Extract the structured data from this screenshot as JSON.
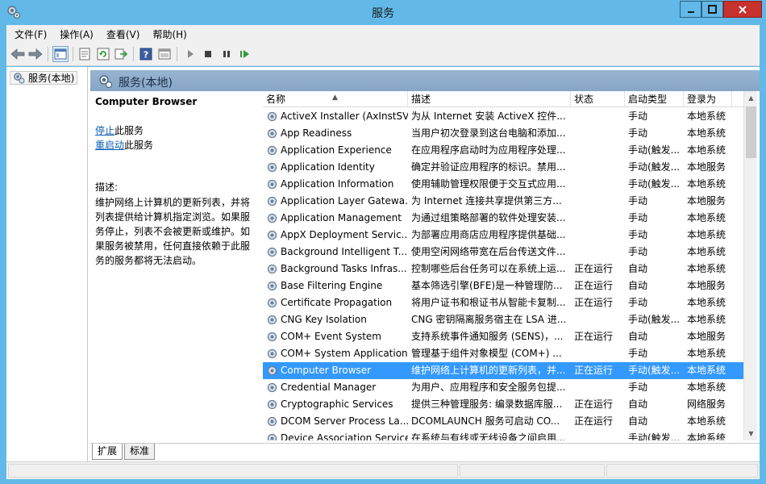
{
  "window": {
    "title": "服务"
  },
  "menu": [
    "文件(F)",
    "操作(A)",
    "查看(V)",
    "帮助(H)"
  ],
  "toolbar": {
    "buttons": [
      "back-icon",
      "forward-icon",
      "console-tree-icon",
      "properties-icon",
      "refresh-icon",
      "export-icon",
      "help-icon",
      "view-icon",
      "play-icon",
      "stop-icon",
      "pause-icon",
      "resume-icon"
    ]
  },
  "tree": {
    "root_label": "服务(本地)"
  },
  "header": {
    "title": "服务(本地)"
  },
  "details": {
    "service_name": "Computer Browser",
    "stop_link": "停止",
    "stop_suffix": "此服务",
    "restart_link": "重启动",
    "restart_suffix": "此服务",
    "desc_label": "描述:",
    "desc_text": "维护网络上计算机的更新列表，并将列表提供给计算机指定浏览。如果服务停止，列表不会被更新或维护。如果服务被禁用，任何直接依赖于此服务的服务都将无法启动。"
  },
  "columns": [
    "名称",
    "描述",
    "状态",
    "启动类型",
    "登录为"
  ],
  "services": [
    {
      "name": "ActiveX Installer (AxInstSV)",
      "desc": "为从 Internet 安装 ActiveX 控件...",
      "status": "",
      "startup": "手动",
      "logon": "本地系统"
    },
    {
      "name": "App Readiness",
      "desc": "当用户初次登录到这台电脑和添加...",
      "status": "",
      "startup": "手动",
      "logon": "本地系统"
    },
    {
      "name": "Application Experience",
      "desc": "在应用程序启动时为应用程序处理...",
      "status": "",
      "startup": "手动(触发...",
      "logon": "本地系统"
    },
    {
      "name": "Application Identity",
      "desc": "确定并验证应用程序的标识。禁用...",
      "status": "",
      "startup": "手动(触发...",
      "logon": "本地服务"
    },
    {
      "name": "Application Information",
      "desc": "使用辅助管理权限便于交互式应用...",
      "status": "",
      "startup": "手动(触发...",
      "logon": "本地系统"
    },
    {
      "name": "Application Layer Gatewa...",
      "desc": "为 Internet 连接共享提供第三方...",
      "status": "",
      "startup": "手动",
      "logon": "本地服务"
    },
    {
      "name": "Application Management",
      "desc": "为通过组策略部署的软件处理安装...",
      "status": "",
      "startup": "手动",
      "logon": "本地系统"
    },
    {
      "name": "AppX Deployment Servic...",
      "desc": "为部署应用商店应用程序提供基础...",
      "status": "",
      "startup": "手动",
      "logon": "本地系统"
    },
    {
      "name": "Background Intelligent T...",
      "desc": "使用空闲网络带宽在后台传送文件...",
      "status": "",
      "startup": "手动",
      "logon": "本地系统"
    },
    {
      "name": "Background Tasks Infras...",
      "desc": "控制哪些后台任务可以在系统上运...",
      "status": "正在运行",
      "startup": "自动",
      "logon": "本地系统"
    },
    {
      "name": "Base Filtering Engine",
      "desc": "基本筛选引擎(BFE)是一种管理防...",
      "status": "正在运行",
      "startup": "自动",
      "logon": "本地服务"
    },
    {
      "name": "Certificate Propagation",
      "desc": "将用户证书和根证书从智能卡复制...",
      "status": "正在运行",
      "startup": "手动",
      "logon": "本地系统"
    },
    {
      "name": "CNG Key Isolation",
      "desc": "CNG 密钥隔离服务宿主在 LSA 进...",
      "status": "",
      "startup": "手动(触发...",
      "logon": "本地系统"
    },
    {
      "name": "COM+ Event System",
      "desc": "支持系统事件通知服务 (SENS)，...",
      "status": "正在运行",
      "startup": "自动",
      "logon": "本地服务"
    },
    {
      "name": "COM+ System Application",
      "desc": "管理基于组件对象模型 (COM+) ...",
      "status": "",
      "startup": "手动",
      "logon": "本地系统"
    },
    {
      "name": "Computer Browser",
      "desc": "维护网络上计算机的更新列表，并...",
      "status": "正在运行",
      "startup": "手动(触发...",
      "logon": "本地系统"
    },
    {
      "name": "Credential Manager",
      "desc": "为用户、应用程序和安全服务包提...",
      "status": "",
      "startup": "手动",
      "logon": "本地系统"
    },
    {
      "name": "Cryptographic Services",
      "desc": "提供三种管理服务: 编录数据库服...",
      "status": "正在运行",
      "startup": "自动",
      "logon": "网络服务"
    },
    {
      "name": "DCOM Server Process La...",
      "desc": "DCOMLAUNCH 服务可启动 CO...",
      "status": "正在运行",
      "startup": "自动",
      "logon": "本地系统"
    },
    {
      "name": "Device Association Service",
      "desc": "在系统与有线或无线设备之间启用...",
      "status": "",
      "startup": "手动(触发...",
      "logon": "本地系统"
    }
  ],
  "selected_row": 15,
  "tabs": [
    "扩展",
    "标准"
  ],
  "colors": {
    "titlebar": "#62b9e8",
    "selection": "#3399ff",
    "header_bar": "#8eabca",
    "close_button": "#c7312e",
    "link": "#0b5fb6"
  }
}
